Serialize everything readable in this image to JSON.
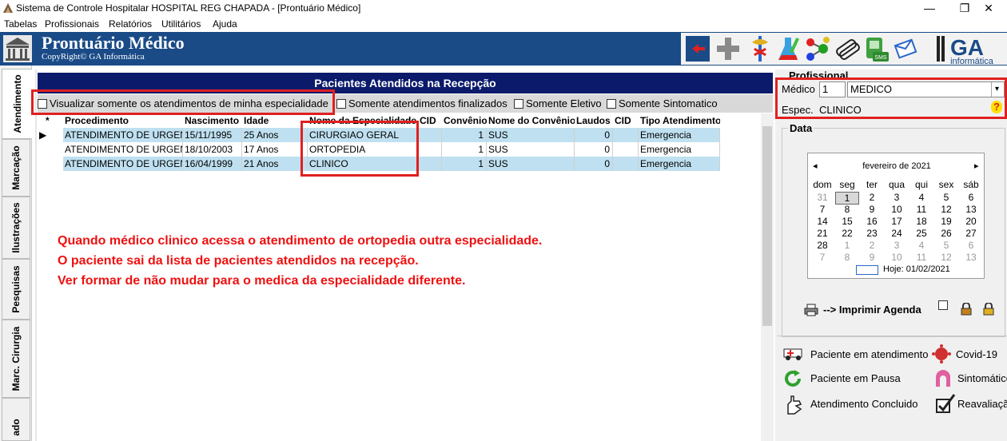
{
  "window": {
    "title": "Sistema de Controle Hospitalar HOSPITAL REG CHAPADA - [Prontuário Médico]",
    "min": "—",
    "restore": "❐",
    "close": "✕"
  },
  "menu": [
    "Tabelas",
    "Profissionais",
    "Relatórios",
    "Utilitários",
    "Ajuda"
  ],
  "header": {
    "title": "Prontuário Médico",
    "copyright": "CopyRight© GA Informática",
    "brand": "GA",
    "brand_sub": "informática"
  },
  "left_tabs": [
    "Atendimento",
    "Marcação",
    "Ilustrações",
    "Pesquisas",
    "Marc. Cirurgia",
    "ado"
  ],
  "panel_title": "Pacientes Atendidos na Recepção",
  "filters": [
    "Visualizar somente os atendimentos de minha especialidade",
    "Somente atendimentos finalizados",
    "Somente Eletivo",
    "Somente Sintomatico"
  ],
  "grid": {
    "marker": "*",
    "columns": [
      "Procedimento",
      "Nascimento",
      "Idade",
      "Nome da Especialidade",
      "CID",
      "Convênio",
      "Nome do Convênio",
      "Laudos",
      "CID",
      "Tipo Atendimento"
    ],
    "rows": [
      [
        "ATENDIMENTO DE URGEN",
        "15/11/1995",
        "25 Anos",
        "CIRURGIAO GERAL",
        "",
        "1",
        "SUS",
        "0",
        "",
        "Emergencia"
      ],
      [
        "ATENDIMENTO DE URGEN",
        "18/10/2003",
        "17 Anos",
        "ORTOPEDIA",
        "",
        "1",
        "SUS",
        "0",
        "",
        "Emergencia"
      ],
      [
        "ATENDIMENTO DE URGEN",
        "16/04/1999",
        "21 Anos",
        "CLINICO",
        "",
        "1",
        "SUS",
        "0",
        "",
        "Emergencia"
      ]
    ]
  },
  "annotation": [
    "Quando médico clinico acessa o atendimento de ortopedia outra especialidade.",
    "O paciente sai da lista de pacientes atendidos na recepção.",
    "Ver formar de não mudar para o medica da especialidade diferente."
  ],
  "profissional": {
    "group_label": "Profissional",
    "medico_label": "Médico",
    "medico_id": "1",
    "medico_name": "MEDICO",
    "espec_label": "Espec.",
    "espec_value": "CLINICO",
    "help": "?"
  },
  "data_group_label": "Data",
  "calendar": {
    "month": "fevereiro de 2021",
    "prev": "◂",
    "next": "▸",
    "weekdays": [
      "dom",
      "seg",
      "ter",
      "qua",
      "qui",
      "sex",
      "sáb"
    ],
    "weeks": [
      [
        "31",
        "1",
        "2",
        "3",
        "4",
        "5",
        "6"
      ],
      [
        "7",
        "8",
        "9",
        "10",
        "11",
        "12",
        "13"
      ],
      [
        "14",
        "15",
        "16",
        "17",
        "18",
        "19",
        "20"
      ],
      [
        "21",
        "22",
        "23",
        "24",
        "25",
        "26",
        "27"
      ],
      [
        "28",
        "1",
        "2",
        "3",
        "4",
        "5",
        "6"
      ],
      [
        "7",
        "8",
        "9",
        "10",
        "11",
        "12",
        "13"
      ]
    ],
    "today_label": "Hoje: 01/02/2021"
  },
  "print_label": "--> Imprimir Agenda",
  "legend": [
    {
      "icon": "ambulance-icon",
      "label": "Paciente em atendimento"
    },
    {
      "icon": "virus-icon",
      "label": "Covid-19"
    },
    {
      "icon": "refresh-icon",
      "label": "Paciente em Pausa"
    },
    {
      "icon": "symptom-icon",
      "label": "Sintomático"
    },
    {
      "icon": "wave-hand-icon",
      "label": "Atendimento Concluido"
    },
    {
      "icon": "checklist-icon",
      "label": "Reavaliação"
    }
  ]
}
